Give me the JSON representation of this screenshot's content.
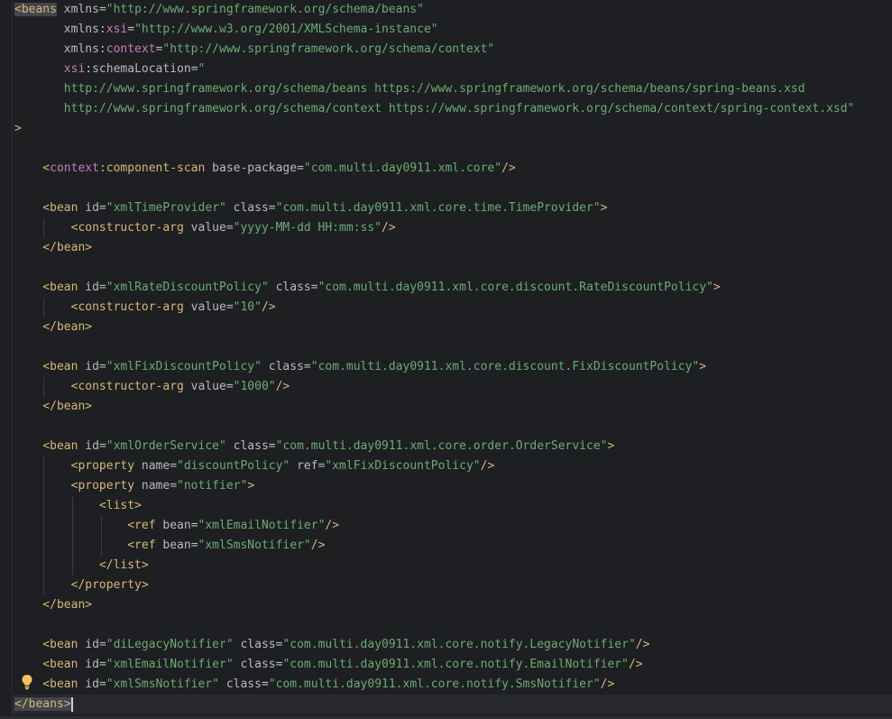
{
  "editor": {
    "language": "xml",
    "current_line_index": 35,
    "lines": [
      [
        {
          "t": "<beans",
          "c": "tag",
          "match": true
        },
        {
          "t": " xmlns",
          "c": "attr"
        },
        {
          "t": "=",
          "c": "attr"
        },
        {
          "t": "\"http://www.springframework.org/schema/beans\"",
          "c": "val"
        }
      ],
      [
        {
          "t": "       xmlns",
          "c": "attr"
        },
        {
          "t": ":",
          "c": "attr"
        },
        {
          "t": "xsi",
          "c": "ns"
        },
        {
          "t": "=",
          "c": "attr"
        },
        {
          "t": "\"http://www.w3.org/2001/XMLSchema-instance\"",
          "c": "val"
        }
      ],
      [
        {
          "t": "       xmlns",
          "c": "attr"
        },
        {
          "t": ":",
          "c": "attr"
        },
        {
          "t": "context",
          "c": "ns"
        },
        {
          "t": "=",
          "c": "attr"
        },
        {
          "t": "\"http://www.springframework.org/schema/context\"",
          "c": "val"
        }
      ],
      [
        {
          "t": "       ",
          "c": "plain"
        },
        {
          "t": "xsi",
          "c": "ns"
        },
        {
          "t": ":schemaLocation",
          "c": "attr"
        },
        {
          "t": "=",
          "c": "attr"
        },
        {
          "t": "\"",
          "c": "val"
        }
      ],
      [
        {
          "t": "       http://www.springframework.org/schema/beans https://www.springframework.org/schema/beans/spring-beans.xsd",
          "c": "val"
        }
      ],
      [
        {
          "t": "       http://www.springframework.org/schema/context https://www.springframework.org/schema/context/spring-context.xsd\"",
          "c": "val"
        }
      ],
      [
        {
          "t": ">",
          "c": "tag"
        }
      ],
      [],
      [
        {
          "t": "    <",
          "c": "tag"
        },
        {
          "t": "context",
          "c": "ns"
        },
        {
          "t": ":component-scan",
          "c": "tag"
        },
        {
          "t": " base-package",
          "c": "attr"
        },
        {
          "t": "=",
          "c": "attr"
        },
        {
          "t": "\"com.multi.day0911.xml.core\"",
          "c": "val"
        },
        {
          "t": "/>",
          "c": "tag"
        }
      ],
      [],
      [
        {
          "t": "    <bean",
          "c": "tag"
        },
        {
          "t": " id",
          "c": "attr"
        },
        {
          "t": "=",
          "c": "attr"
        },
        {
          "t": "\"xmlTimeProvider\"",
          "c": "val"
        },
        {
          "t": " class",
          "c": "attr"
        },
        {
          "t": "=",
          "c": "attr"
        },
        {
          "t": "\"com.multi.day0911.xml.core.time.TimeProvider\"",
          "c": "val"
        },
        {
          "t": ">",
          "c": "tag"
        }
      ],
      [
        {
          "t": "        <constructor-arg",
          "c": "tag"
        },
        {
          "t": " value",
          "c": "attr"
        },
        {
          "t": "=",
          "c": "attr"
        },
        {
          "t": "\"yyyy-MM-dd HH:mm:ss\"",
          "c": "val"
        },
        {
          "t": "/>",
          "c": "tag"
        }
      ],
      [
        {
          "t": "    </bean>",
          "c": "tag"
        }
      ],
      [],
      [
        {
          "t": "    <bean",
          "c": "tag"
        },
        {
          "t": " id",
          "c": "attr"
        },
        {
          "t": "=",
          "c": "attr"
        },
        {
          "t": "\"xmlRateDiscountPolicy\"",
          "c": "val"
        },
        {
          "t": " class",
          "c": "attr"
        },
        {
          "t": "=",
          "c": "attr"
        },
        {
          "t": "\"com.multi.day0911.xml.core.discount.RateDiscountPolicy\"",
          "c": "val"
        },
        {
          "t": ">",
          "c": "tag"
        }
      ],
      [
        {
          "t": "        <constructor-arg",
          "c": "tag"
        },
        {
          "t": " value",
          "c": "attr"
        },
        {
          "t": "=",
          "c": "attr"
        },
        {
          "t": "\"10\"",
          "c": "val"
        },
        {
          "t": "/>",
          "c": "tag"
        }
      ],
      [
        {
          "t": "    </bean>",
          "c": "tag"
        }
      ],
      [],
      [
        {
          "t": "    <bean",
          "c": "tag"
        },
        {
          "t": " id",
          "c": "attr"
        },
        {
          "t": "=",
          "c": "attr"
        },
        {
          "t": "\"xmlFixDiscountPolicy\"",
          "c": "val"
        },
        {
          "t": " class",
          "c": "attr"
        },
        {
          "t": "=",
          "c": "attr"
        },
        {
          "t": "\"com.multi.day0911.xml.core.discount.FixDiscountPolicy\"",
          "c": "val"
        },
        {
          "t": ">",
          "c": "tag"
        }
      ],
      [
        {
          "t": "        <constructor-arg",
          "c": "tag"
        },
        {
          "t": " value",
          "c": "attr"
        },
        {
          "t": "=",
          "c": "attr"
        },
        {
          "t": "\"1000\"",
          "c": "val"
        },
        {
          "t": "/>",
          "c": "tag"
        }
      ],
      [
        {
          "t": "    </bean>",
          "c": "tag"
        }
      ],
      [],
      [
        {
          "t": "    <bean",
          "c": "tag"
        },
        {
          "t": " id",
          "c": "attr"
        },
        {
          "t": "=",
          "c": "attr"
        },
        {
          "t": "\"xmlOrderService\"",
          "c": "val"
        },
        {
          "t": " class",
          "c": "attr"
        },
        {
          "t": "=",
          "c": "attr"
        },
        {
          "t": "\"com.multi.day0911.xml.core.order.OrderService\"",
          "c": "val"
        },
        {
          "t": ">",
          "c": "tag"
        }
      ],
      [
        {
          "t": "        <property",
          "c": "tag"
        },
        {
          "t": " name",
          "c": "attr"
        },
        {
          "t": "=",
          "c": "attr"
        },
        {
          "t": "\"discountPolicy\"",
          "c": "val"
        },
        {
          "t": " ref",
          "c": "attr"
        },
        {
          "t": "=",
          "c": "attr"
        },
        {
          "t": "\"xmlFixDiscountPolicy\"",
          "c": "val"
        },
        {
          "t": "/>",
          "c": "tag"
        }
      ],
      [
        {
          "t": "        <property",
          "c": "tag"
        },
        {
          "t": " name",
          "c": "attr"
        },
        {
          "t": "=",
          "c": "attr"
        },
        {
          "t": "\"notifier\"",
          "c": "val"
        },
        {
          "t": ">",
          "c": "tag"
        }
      ],
      [
        {
          "t": "            <list>",
          "c": "tag"
        }
      ],
      [
        {
          "t": "                <ref",
          "c": "tag"
        },
        {
          "t": " bean",
          "c": "attr"
        },
        {
          "t": "=",
          "c": "attr"
        },
        {
          "t": "\"xmlEmailNotifier\"",
          "c": "val"
        },
        {
          "t": "/>",
          "c": "tag"
        }
      ],
      [
        {
          "t": "                <ref",
          "c": "tag"
        },
        {
          "t": " bean",
          "c": "attr"
        },
        {
          "t": "=",
          "c": "attr"
        },
        {
          "t": "\"xmlSmsNotifier\"",
          "c": "val"
        },
        {
          "t": "/>",
          "c": "tag"
        }
      ],
      [
        {
          "t": "            </list>",
          "c": "tag"
        }
      ],
      [
        {
          "t": "        </property>",
          "c": "tag"
        }
      ],
      [
        {
          "t": "    </bean>",
          "c": "tag"
        }
      ],
      [],
      [
        {
          "t": "    <bean",
          "c": "tag"
        },
        {
          "t": " id",
          "c": "attr"
        },
        {
          "t": "=",
          "c": "attr"
        },
        {
          "t": "\"diLegacyNotifier\"",
          "c": "val"
        },
        {
          "t": " class",
          "c": "attr"
        },
        {
          "t": "=",
          "c": "attr"
        },
        {
          "t": "\"com.multi.day0911.xml.core.notify.LegacyNotifier\"",
          "c": "val"
        },
        {
          "t": "/>",
          "c": "tag"
        }
      ],
      [
        {
          "t": "    <bean",
          "c": "tag"
        },
        {
          "t": " id",
          "c": "attr"
        },
        {
          "t": "=",
          "c": "attr"
        },
        {
          "t": "\"xmlEmailNotifier\"",
          "c": "val"
        },
        {
          "t": " class",
          "c": "attr"
        },
        {
          "t": "=",
          "c": "attr"
        },
        {
          "t": "\"com.multi.day0911.xml.core.notify.EmailNotifier\"",
          "c": "val"
        },
        {
          "t": "/>",
          "c": "tag"
        }
      ],
      [
        {
          "t": "    <bean",
          "c": "tag"
        },
        {
          "t": " id",
          "c": "attr"
        },
        {
          "t": "=",
          "c": "attr"
        },
        {
          "t": "\"xmlSmsNotifier\"",
          "c": "val"
        },
        {
          "t": " class",
          "c": "attr"
        },
        {
          "t": "=",
          "c": "attr"
        },
        {
          "t": "\"com.multi.day0911.xml.core.notify.SmsNotifier\"",
          "c": "val"
        },
        {
          "t": "/>",
          "c": "tag"
        }
      ],
      [
        {
          "t": "</beans>",
          "c": "tag",
          "match": true
        }
      ]
    ]
  },
  "gutter": {
    "intention_icon": "lightbulb-icon"
  },
  "colors": {
    "background": "#1e1f22",
    "tag": "#d5b778",
    "attribute": "#bababa",
    "namespace": "#c77dbb",
    "value": "#6aab73",
    "current_line": "#26282e",
    "bulb": "#f2c55c"
  }
}
